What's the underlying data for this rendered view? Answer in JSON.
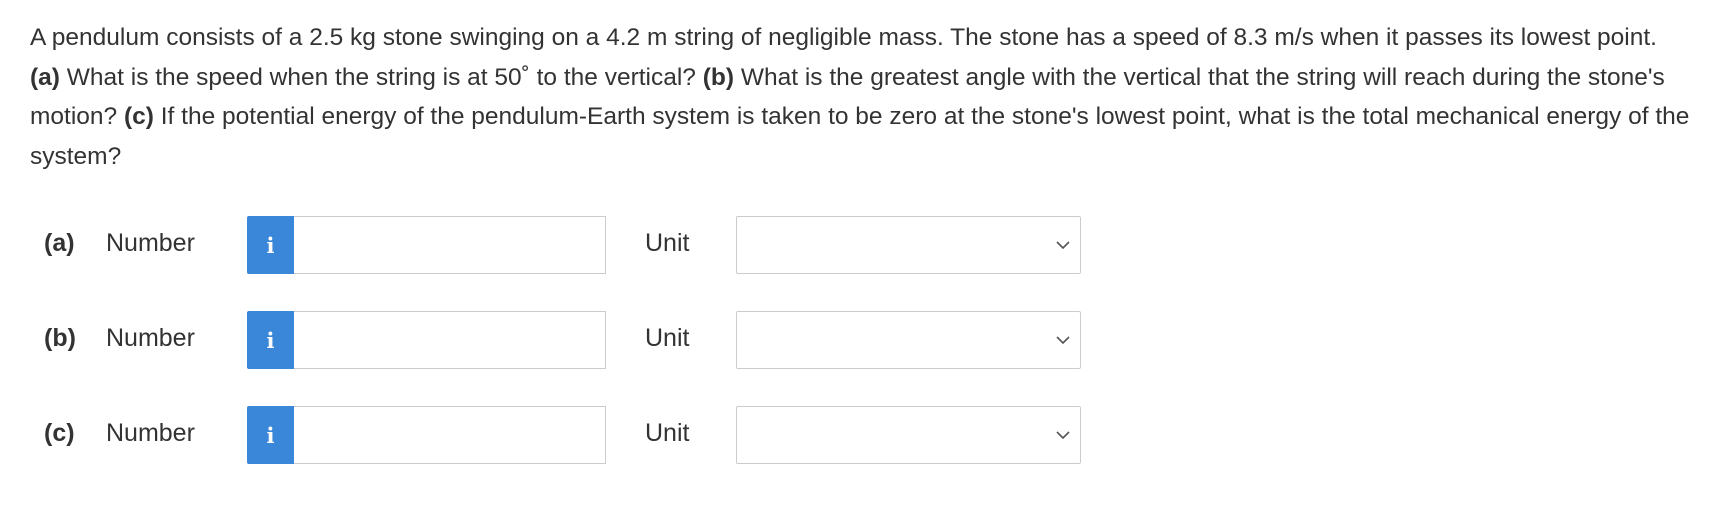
{
  "question": {
    "intro": "A pendulum consists of a 2.5 kg stone swinging on a 4.2 m string of negligible mass. The stone has a speed of 8.3 m/s when it passes its lowest point.",
    "part_a_label": "(a)",
    "part_a_text": "What is the speed when the string is at 50˚ to the vertical?",
    "part_b_label": "(b)",
    "part_b_text": "What is the greatest angle with the vertical that the string will reach during the stone's motion?",
    "part_c_label": "(c)",
    "part_c_text": "If the potential energy of the pendulum-Earth system is taken to be zero at the stone's lowest point, what is the total mechanical energy of the system?"
  },
  "answers": [
    {
      "part": "(a)",
      "number_label": "Number",
      "info_icon": "i",
      "number_value": "",
      "unit_label": "Unit",
      "unit_value": ""
    },
    {
      "part": "(b)",
      "number_label": "Number",
      "info_icon": "i",
      "number_value": "",
      "unit_label": "Unit",
      "unit_value": ""
    },
    {
      "part": "(c)",
      "number_label": "Number",
      "info_icon": "i",
      "number_value": "",
      "unit_label": "Unit",
      "unit_value": ""
    }
  ],
  "colors": {
    "info_button": "#3a86d8",
    "text": "#333333",
    "border": "#cccccc"
  },
  "icons": {
    "info": "info-icon",
    "dropdown": "chevron-down-icon"
  }
}
